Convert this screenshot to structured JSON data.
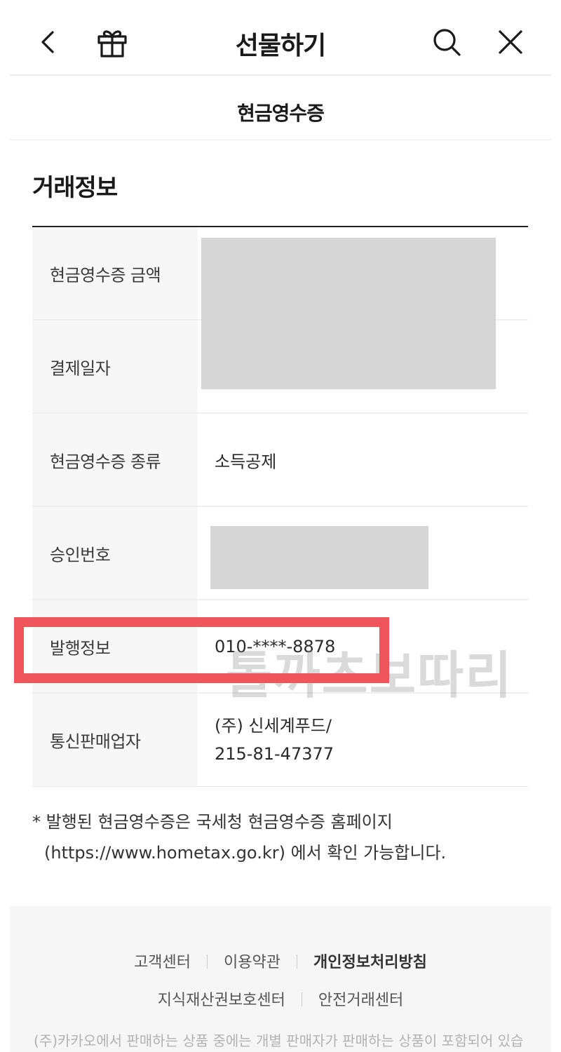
{
  "header": {
    "title": "선물하기",
    "back_icon": "chevron-left-icon",
    "gift_icon": "gift-icon",
    "search_icon": "search-icon",
    "close_icon": "close-icon"
  },
  "subheader": {
    "title": "현금영수증"
  },
  "section": {
    "title": "거래정보"
  },
  "rows": [
    {
      "label": "현금영수증 금액",
      "value": ""
    },
    {
      "label": "결제일자",
      "value": ""
    },
    {
      "label": "현금영수증 종류",
      "value": "소득공제"
    },
    {
      "label": "승인번호",
      "value": ""
    },
    {
      "label": "발행정보",
      "value": "010-****-8878"
    },
    {
      "label": "통신판매업자",
      "value_line1": "(주) 신세계푸드/",
      "value_line2": "215-81-47377"
    }
  ],
  "watermark": "톨까츠보따리",
  "note": {
    "line1": "* 발행된 현금영수증은 국세청 현금영수증 홈페이지",
    "line2": "(https://www.hometax.go.kr) 에서 확인 가능합니다."
  },
  "footer": {
    "links_row1": [
      "고객센터",
      "이용약관",
      "개인정보처리방침"
    ],
    "links_row2": [
      "지식재산권보호센터",
      "안전거래센터"
    ],
    "disclaimer": "(주)카카오에서 판매하는 상품 중에는 개별 판매자가 판매하는 상품이 포함되어 있습"
  },
  "colors": {
    "highlight": "#f0555c",
    "redaction": "#d6d6d6"
  }
}
